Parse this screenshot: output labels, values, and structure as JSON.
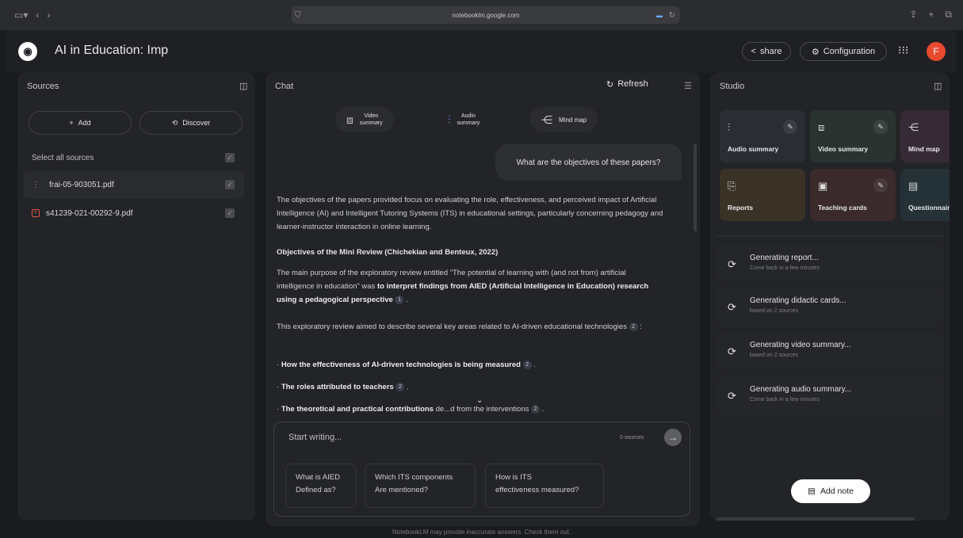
{
  "browser": {
    "url": "notebooklm.google.com"
  },
  "header": {
    "title": "AI in Education: Imp",
    "share_label": "share",
    "config_label": "Configuration",
    "avatar_letter": "F"
  },
  "sources": {
    "title": "Sources",
    "add_label": "Add",
    "discover_label": "Discover",
    "select_all_label": "Select all sources",
    "items": [
      {
        "name": "frai-05-903051.pdf"
      },
      {
        "name": "s41239-021-00292-9.pdf"
      }
    ]
  },
  "chat": {
    "title": "Chat",
    "refresh_label": "Refresh",
    "chips": [
      {
        "label_line1": "Video",
        "label_line2": "summary"
      },
      {
        "label_line1": "Audio",
        "label_line2": "summary"
      },
      {
        "label_line1": "Mind map",
        "label_line2": ""
      }
    ],
    "user_message": "What are the objectives of these papers?",
    "response": {
      "intro": "The objectives of the papers provided focus on evaluating the role, effectiveness, and perceived impact of Artificial Intelligence (AI) and Intelligent Tutoring Systems (ITS) in educational settings, particularly concerning pedagogy and learner-instructor interaction in online learning.",
      "heading": "Objectives of the Mini Review (Chichekian and Benteux, 2022)",
      "para2_start": "The main purpose of the exploratory review entitled \"The potential of learning with (and not from) artificial intelligence in education\" was ",
      "para2_bold": "to interpret findings from AIED (Artificial Intelligence in Education) research using a pedagogical perspective",
      "para2_cite": "1",
      "para3": "This exploratory review aimed to describe several key areas related to AI-driven educational technologies",
      "para3_cite": "2",
      "bullet1": "How the effectiveness of AI-driven technologies is being measured",
      "bullet1_cite": "2",
      "bullet2": "The roles attributed to teachers",
      "bullet2_cite": "2",
      "bullet3_bold": "The theoretical and practical contributions",
      "bullet3_rest": " de...d from the interventions",
      "bullet3_cite": "2"
    },
    "input": {
      "placeholder": "Start writing...",
      "source_count": "0 sources"
    },
    "suggestions": [
      {
        "line1": "What is AIED",
        "line2": "Defined as?"
      },
      {
        "line1": "Which ITS components",
        "line2": "Are mentioned?"
      },
      {
        "line1": "How is ITS",
        "line2": "effectiveness measured?"
      }
    ]
  },
  "studio": {
    "title": "Studio",
    "tiles": [
      {
        "label": "Audio summary",
        "icon": "audio-wave-icon",
        "color": "#2b2d35"
      },
      {
        "label": "Video summary",
        "icon": "video-icon",
        "color": "#2a3330"
      },
      {
        "label": "Mind map",
        "icon": "mind-map-icon",
        "color": "#352a36"
      },
      {
        "label": "Reports",
        "icon": "report-icon",
        "color": "#3a3226"
      },
      {
        "label": "Teaching cards",
        "icon": "cards-icon",
        "color": "#3a2a2c"
      },
      {
        "label": "Questionnair",
        "icon": "quiz-icon",
        "color": "#243237"
      }
    ],
    "generating": [
      {
        "title": "Generating report...",
        "subtitle": "Come back in a few minutes"
      },
      {
        "title": "Generating didactic cards...",
        "subtitle": "based on 2 sources"
      },
      {
        "title": "Generating video summary...",
        "subtitle": "based on 2 sources"
      },
      {
        "title": "Generating audio summary...",
        "subtitle": "Come back in a few minutes"
      }
    ],
    "add_note_label": "Add note"
  },
  "footer": {
    "disclaimer": "NotebookLM may provide inaccurate answers. Check them out."
  }
}
